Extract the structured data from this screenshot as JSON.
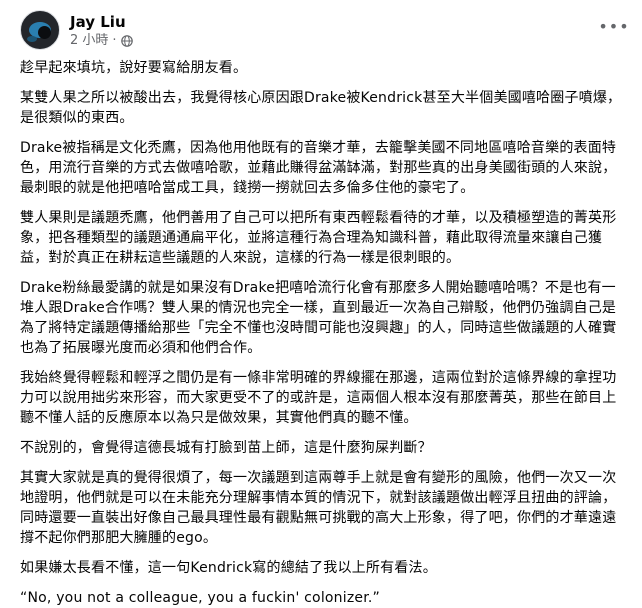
{
  "post": {
    "author": "Jay Liu",
    "time": "2 小時",
    "separator": "·",
    "paragraphs": [
      "趁早起來填坑，說好要寫給朋友看。",
      "某雙人果之所以被酸出去，我覺得核心原因跟Drake被Kendrick甚至大半個美國嘻哈圈子噴爆，是很類似的東西。",
      "Drake被指稱是文化禿鷹，因為他用他既有的音樂才華，去籠擊美國不同地區嘻哈音樂的表面特色，用流行音樂的方式去做嘻哈歌，並藉此賺得盆滿缽滿，對那些真的出身美國街頭的人來說，最刺眼的就是他把嘻哈當成工具，錢撈一撈就回去多倫多住他的豪宅了。",
      "雙人果則是議題禿鷹，他們善用了自己可以把所有東西輕鬆看待的才華，以及積極塑造的菁英形象，把各種類型的議題通通扁平化，並將這種行為合理為知識科普，藉此取得流量來讓自己獲益，對於真正在耕耘這些議題的人來說，這樣的行為一樣是很刺眼的。",
      "Drake粉絲最愛講的就是如果沒有Drake把嘻哈流行化會有那麼多人開始聽嘻哈嗎？不是也有一堆人跟Drake合作嗎？雙人果的情況也完全一樣，直到最近一次為自己辯駁，他們仍強調自己是為了將特定議題傳播給那些「完全不懂也沒時間可能也沒興趣」的人，同時這些做議題的人確實也為了拓展曝光度而必須和他們合作。",
      "我始終覺得輕鬆和輕浮之間仍是有一條非常明確的界線擺在那邊，這兩位對於這條界線的拿捏功力可以說用拙劣來形容，而大家更受不了的或許是，這兩個人根本沒有那麼菁英，那些在節目上聽不懂人話的反應原本以為只是做效果，其實他們真的聽不懂。",
      "不說別的，會覺得這德長城有打臉到苗上師，這是什麼狗屎判斷？",
      "其實大家就是真的覺得很煩了，每一次議題到這兩尊手上就是會有變形的風險，他們一次又一次地證明，他們就是可以在未能充分理解事情本質的情況下，就對該議題做出輕浮且扭曲的評論，同時還要一直裝出好像自己最具理性最有觀點無可挑戰的高大上形象，得了吧，你們的才華遠遠撐不起你們那肥大臃腫的ego。",
      "如果嫌太長看不懂，這一句Kendrick寫的總結了我以上所有看法。",
      "“No, you not a colleague, you a fuckin' colonizer.”"
    ]
  },
  "icons": {
    "avatar": "avatar-image",
    "privacy": "globe-icon",
    "more": "more-options-icon"
  },
  "colors": {
    "text": "#050505",
    "secondary": "#65676b"
  }
}
